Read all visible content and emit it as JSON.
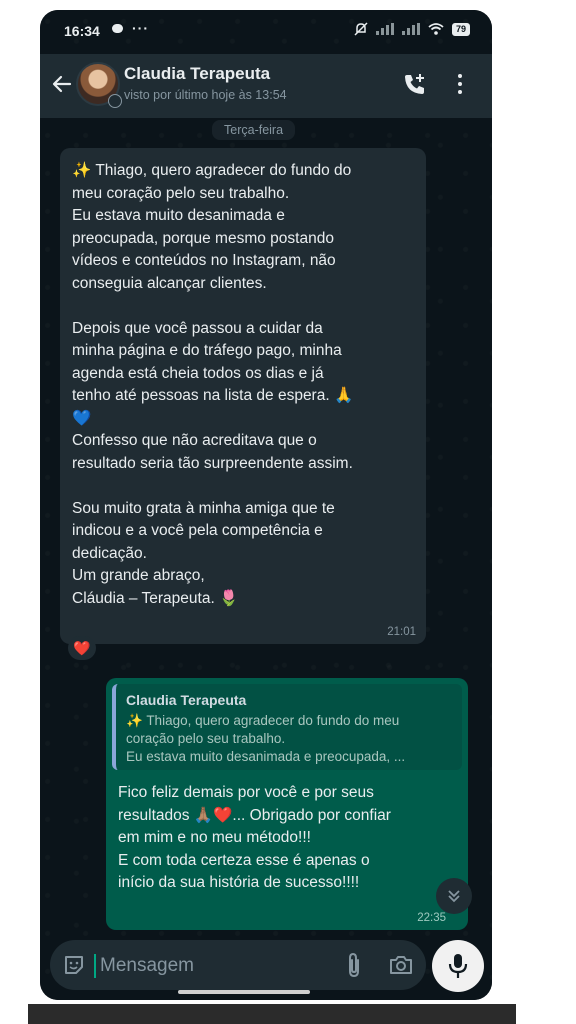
{
  "status_bar": {
    "time": "16:34",
    "more": "···",
    "battery": "79"
  },
  "header": {
    "contact_name": "Claudia Terapeuta",
    "last_seen": "visto por último hoje às 13:54"
  },
  "chat": {
    "date_divider": "Terça-feira",
    "incoming": {
      "text": "✨ Thiago, quero agradecer do fundo do\nmeu coração pelo seu trabalho.\nEu estava muito desanimada e\npreocupada, porque mesmo postando\nvídeos e conteúdos no Instagram, não\nconseguia alcançar clientes.\n\nDepois que você passou a cuidar da\nminha página e do tráfego pago, minha\nagenda está cheia todos os dias e já\ntenho até pessoas na lista de espera. 🙏\n💙\nConfesso que não acreditava que o\nresultado seria tão surpreendente assim.\n\nSou muito grata à minha amiga que te\nindicou e a você pela competência e\ndedicação.\nUm grande abraço,\nCláudia – Terapeuta. 🌷",
      "time": "21:01",
      "reaction": "❤️"
    },
    "outgoing": {
      "quote_author": "Claudia Terapeuta",
      "quote_text": "✨ Thiago, quero agradecer do fundo do meu\ncoração pelo seu trabalho.\nEu estava muito desanimada e preocupada, ...",
      "text": "Fico feliz demais por você e por seus\nresultados 🙏🏽❤️... Obrigado por confiar\nem mim e no meu método!!!\nE com toda certeza esse é apenas o\ninício da sua história de sucesso!!!!",
      "time": "22:35"
    }
  },
  "composer": {
    "placeholder": "Mensagem"
  },
  "icons": {
    "back": "arrow-left-icon",
    "call": "add-call-icon",
    "menu": "more-vertical-icon",
    "emoji": "sticker-icon",
    "attach": "paperclip-icon",
    "camera": "camera-icon",
    "mic": "microphone-icon",
    "scroll": "chevrons-down-icon"
  },
  "colors": {
    "background": "#0b141a",
    "incoming_bubble": "#202c33",
    "outgoing_bubble": "#005c4b",
    "accent": "#00a884"
  }
}
